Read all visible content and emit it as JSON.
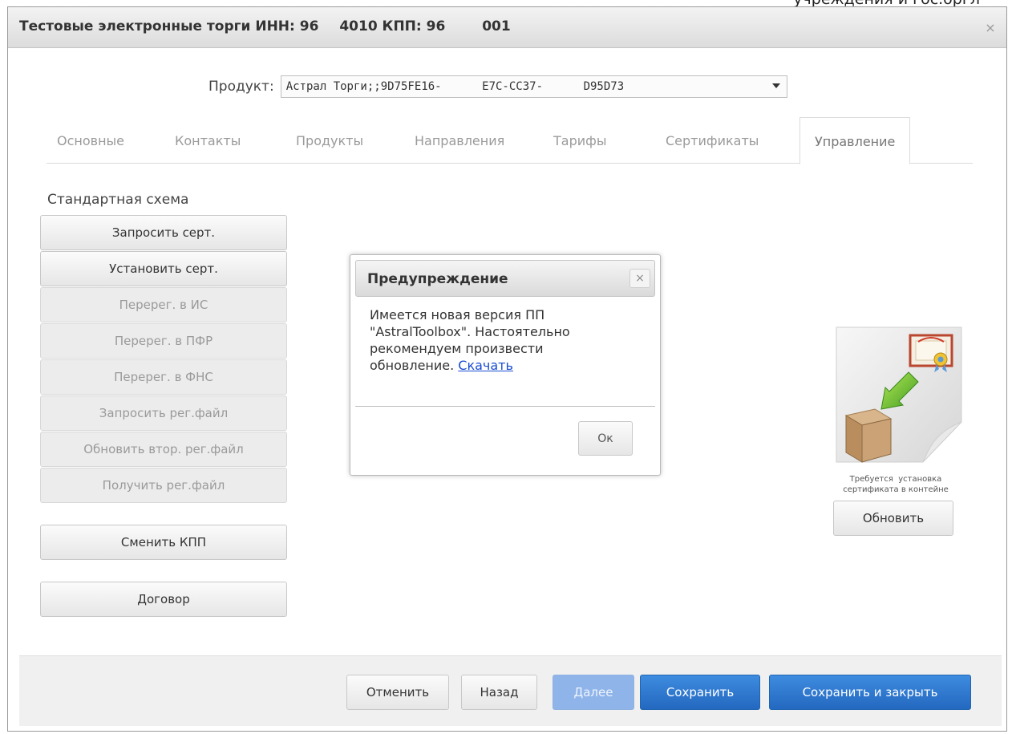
{
  "top_cut_text": "учреждения и гос.оргл",
  "window": {
    "title_parts": [
      "Тестовые электронные торги ИНН: 96",
      "4010 КПП: 96",
      "001"
    ],
    "close_symbol": "×"
  },
  "product": {
    "label": "Продукт:",
    "value": "Астрал Торги;;9D75FE16-      E7C-CC37-      D95D73"
  },
  "tabs": [
    {
      "label": "Основные",
      "active": false
    },
    {
      "label": "Контакты",
      "active": false
    },
    {
      "label": "Продукты",
      "active": false
    },
    {
      "label": "Направления",
      "active": false
    },
    {
      "label": "Тарифы",
      "active": false
    },
    {
      "label": "Сертификаты",
      "active": false
    },
    {
      "label": "Управление",
      "active": true
    }
  ],
  "sidebar": {
    "section_label": "Стандартная схема",
    "buttons": [
      {
        "label": "Запросить серт.",
        "enabled": true
      },
      {
        "label": "Установить серт.",
        "enabled": true
      },
      {
        "label": "Перерег. в ИС",
        "enabled": false
      },
      {
        "label": "Перерег. в ПФР",
        "enabled": false
      },
      {
        "label": "Перерег. в ФНС",
        "enabled": false
      },
      {
        "label": "Запросить рег.файл",
        "enabled": false
      },
      {
        "label": "Обновить втор. рег.файл",
        "enabled": false
      },
      {
        "label": "Получить рег.файл",
        "enabled": false
      }
    ],
    "change_kpp": "Сменить КПП",
    "contract": "Договор"
  },
  "cert_panel": {
    "icon": "certificate-install-icon",
    "caption_line1": "Требуется  установка",
    "caption_line2": "сертификата в контейне",
    "refresh_label": "Обновить"
  },
  "footer": {
    "cancel": "Отменить",
    "back": "Назад",
    "next": "Далее",
    "save": "Сохранить",
    "save_close": "Сохранить и закрыть"
  },
  "dialog": {
    "title": "Предупреждение",
    "close_symbol": "×",
    "line1": "Имеется новая версия ПП",
    "line2": "\"AstralToolbox\". Настоятельно",
    "line3": "рекомендуем произвести",
    "line4_prefix": "обновление. ",
    "link": "Скачать",
    "ok": "Ок"
  },
  "colors": {
    "primary": "#2a6fc6",
    "primary_disabled": "#8fb4ea",
    "link": "#1a4cd1"
  }
}
